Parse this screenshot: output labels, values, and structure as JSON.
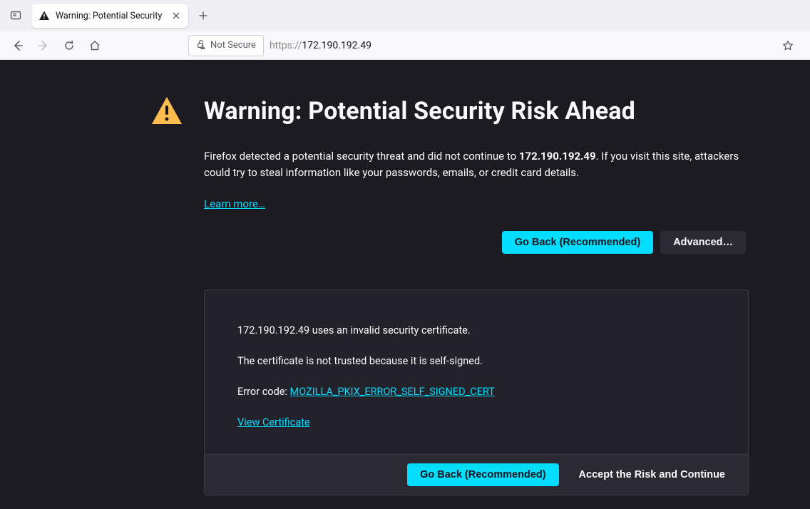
{
  "tab": {
    "title": "Warning: Potential Security Risk"
  },
  "urlbar": {
    "not_secure_label": "Not Secure",
    "scheme": "https://",
    "host": "172.190.192.49"
  },
  "page": {
    "heading": "Warning: Potential Security Risk Ahead",
    "para_lead": "Firefox detected a potential security threat and did not continue to ",
    "para_host": "172.190.192.49",
    "para_tail": ". If you visit this site, attackers could try to steal information like your passwords, emails, or credit card details.",
    "learn_more": "Learn more…",
    "go_back": "Go Back (Recommended)",
    "advanced": "Advanced…"
  },
  "details": {
    "line1": "172.190.192.49 uses an invalid security certificate.",
    "line2": "The certificate is not trusted because it is self-signed.",
    "error_label": "Error code: ",
    "error_code": "MOZILLA_PKIX_ERROR_SELF_SIGNED_CERT",
    "view_cert": "View Certificate",
    "go_back": "Go Back (Recommended)",
    "accept": "Accept the Risk and Continue"
  }
}
